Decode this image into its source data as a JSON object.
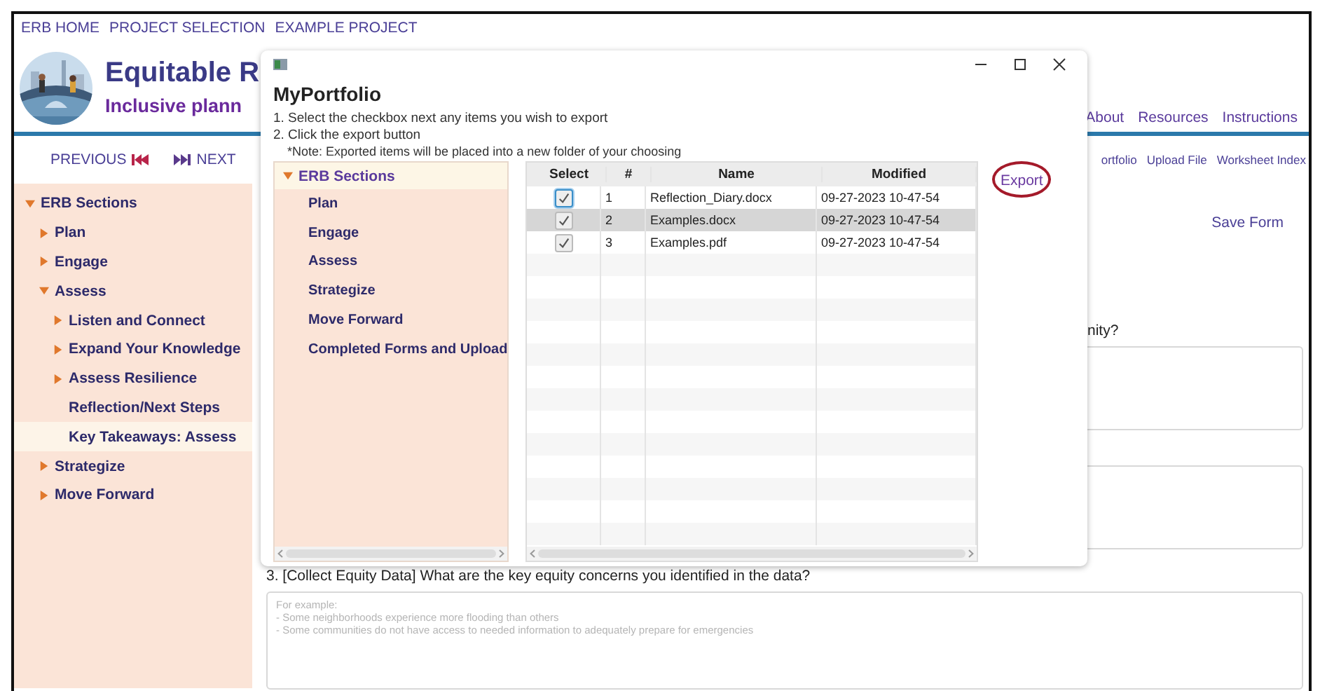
{
  "top_nav": [
    "ERB HOME",
    "PROJECT SELECTION",
    "EXAMPLE PROJECT"
  ],
  "header": {
    "title": "Equitable R",
    "subtitle": "Inclusive plann"
  },
  "main_nav": [
    "About",
    "Resources",
    "Instructions"
  ],
  "pager": {
    "previous": "PREVIOUS",
    "next": "NEXT"
  },
  "tool_links": [
    "ortfolio",
    "Upload File",
    "Worksheet Index"
  ],
  "save_button": "Save Form",
  "sidebar": {
    "items": [
      {
        "label": "ERB Sections",
        "kind": "group",
        "expanded": true,
        "selected": false,
        "children": [
          {
            "label": "Plan",
            "kind": "group",
            "expanded": false,
            "selected": false
          },
          {
            "label": "Engage",
            "kind": "group",
            "expanded": false,
            "selected": false
          },
          {
            "label": "Assess",
            "kind": "group",
            "expanded": true,
            "selected": false,
            "children": [
              {
                "label": "Listen and Connect",
                "kind": "group",
                "expanded": false,
                "selected": false
              },
              {
                "label": "Expand Your Knowledge",
                "kind": "group",
                "expanded": false,
                "selected": false
              },
              {
                "label": "Assess Resilience",
                "kind": "group",
                "expanded": false,
                "selected": false
              },
              {
                "label": "Reflection/Next Steps",
                "kind": "page",
                "selected": false
              },
              {
                "label": "Key Takeaways: Assess",
                "kind": "page",
                "selected": true
              }
            ]
          },
          {
            "label": "Strategize",
            "kind": "group",
            "expanded": false,
            "selected": false
          },
          {
            "label": "Move Forward",
            "kind": "group",
            "expanded": false,
            "selected": false
          }
        ]
      }
    ]
  },
  "form": {
    "questions": [
      {
        "kind": "text",
        "label": "nity?"
      },
      {
        "kind": "text"
      },
      {
        "kind": "text",
        "label": "3. [Collect Equity Data] What are the key equity concerns you identified in the data?",
        "placeholder": "For example:\n- Some neighborhoods experience more flooding than others\n- Some communities do not have access to needed information to adequately prepare for emergencies"
      }
    ]
  },
  "dialog": {
    "title": "MyPortfolio",
    "instructions": [
      "1. Select the checkbox next any items you wish to export",
      "2. Click the export button"
    ],
    "note": "*Note: Exported items will be placed into a new folder of your choosing",
    "tree": {
      "label": "ERB Sections",
      "expanded": true,
      "selected": true,
      "children": [
        {
          "label": "Plan",
          "selected": false
        },
        {
          "label": "Engage",
          "selected": false
        },
        {
          "label": "Assess",
          "selected": false
        },
        {
          "label": "Strategize",
          "selected": false
        },
        {
          "label": "Move Forward",
          "selected": false
        },
        {
          "label": "Completed Forms and Upload",
          "selected": false
        }
      ]
    },
    "table": {
      "columns": [
        "Select",
        "#",
        "Name",
        "Modified"
      ],
      "rows": [
        {
          "checked": true,
          "selected": false,
          "number": "1",
          "name": "Reflection_Diary.docx",
          "modified": "09-27-2023 10-47-54"
        },
        {
          "checked": true,
          "selected": true,
          "number": "2",
          "name": "Examples.docx",
          "modified": "09-27-2023 10-47-54"
        },
        {
          "checked": true,
          "selected": false,
          "number": "3",
          "name": "Examples.pdf",
          "modified": "09-27-2023 10-47-54"
        }
      ]
    },
    "export_button": "Export"
  }
}
